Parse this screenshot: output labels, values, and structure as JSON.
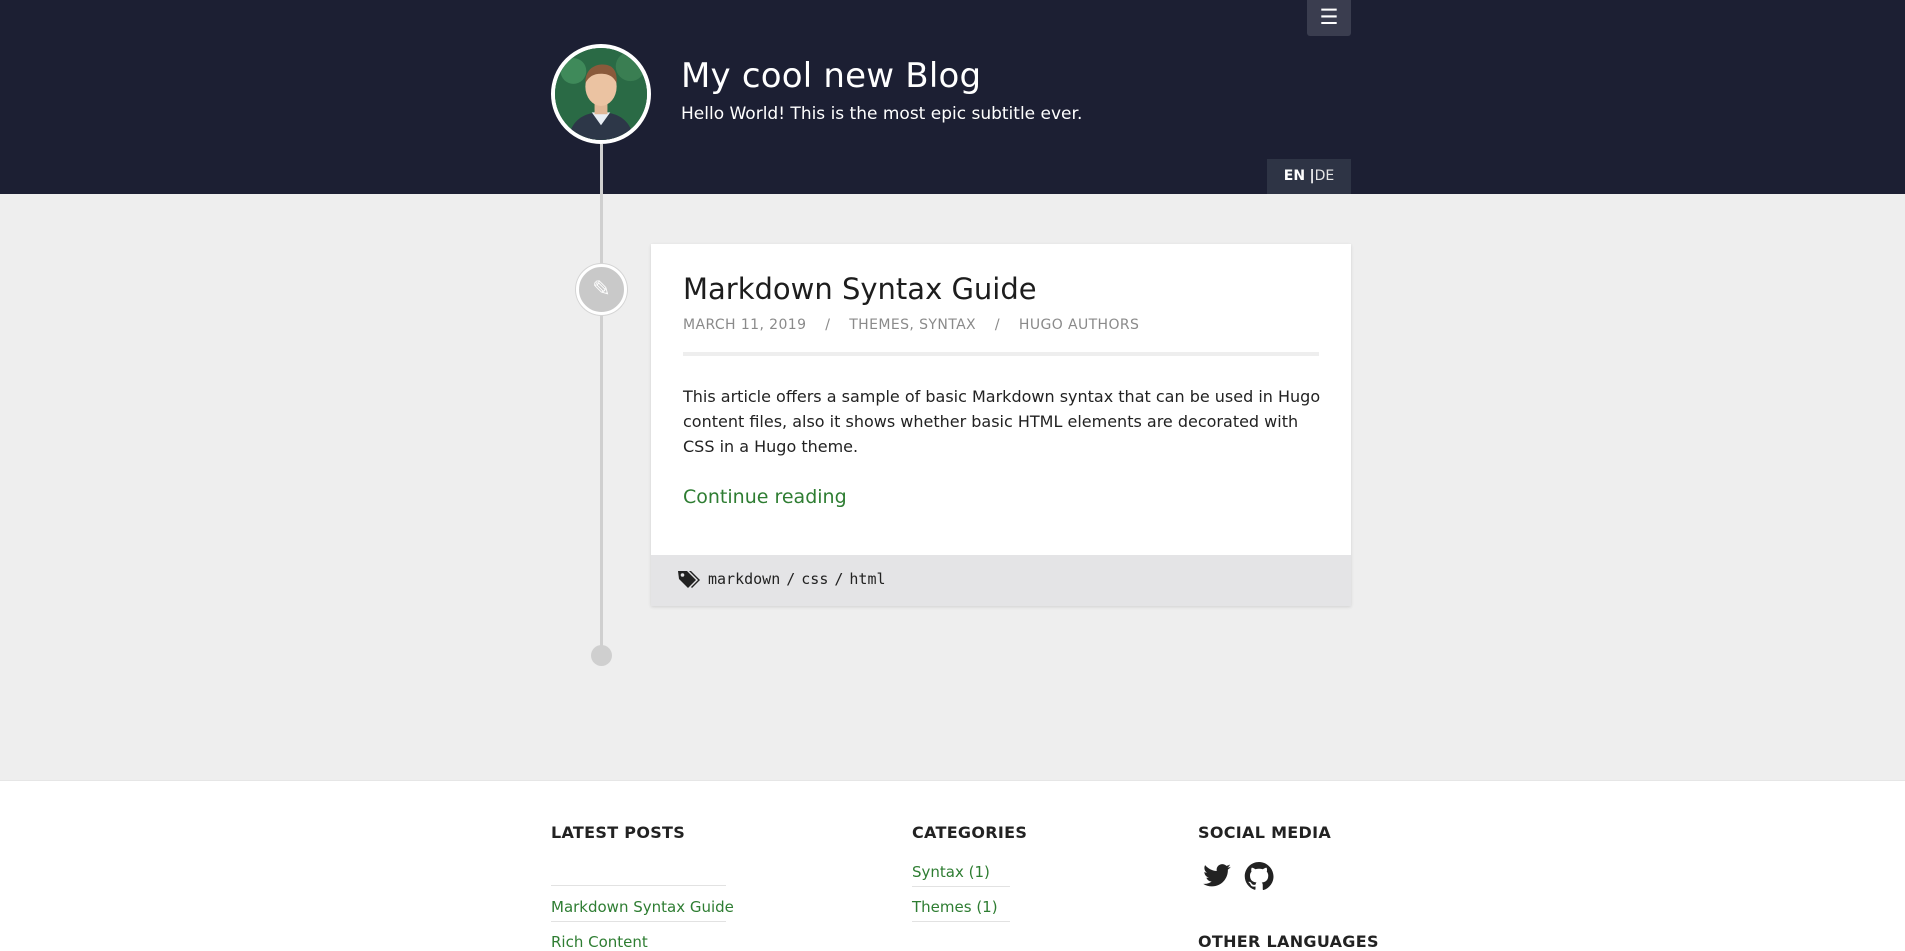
{
  "header": {
    "menu_icon": "hamburger-icon",
    "menu_glyph": "☰",
    "title": "My cool new Blog",
    "subtitle": "Hello World! This is the most epic subtitle ever.",
    "languages": {
      "current": "EN",
      "separator": "|",
      "other": "DE"
    }
  },
  "post": {
    "title": "Markdown Syntax Guide",
    "date": "MARCH 11, 2019",
    "meta_sep": "/",
    "categories": [
      {
        "label": "THEMES"
      },
      {
        "label": "SYNTAX"
      }
    ],
    "category_sep": ",",
    "author": "HUGO AUTHORS",
    "summary": "This article offers a sample of basic Markdown syntax that can be used in Hugo content files, also it shows whether basic HTML elements are decorated with CSS in a Hugo theme.",
    "continue_label": "Continue reading",
    "timeline_icon": "pencil-icon",
    "tags_icon": "tags-icon",
    "tags": [
      "markdown",
      "css",
      "html"
    ],
    "tag_sep": "/"
  },
  "footer": {
    "latest_posts": {
      "heading": "LATEST POSTS",
      "items": [
        {
          "label": "Markdown Syntax Guide"
        },
        {
          "label": "Rich Content"
        }
      ]
    },
    "categories": {
      "heading": "CATEGORIES",
      "items": [
        {
          "label": "Syntax (1)"
        },
        {
          "label": "Themes (1)"
        }
      ]
    },
    "social": {
      "heading": "SOCIAL MEDIA",
      "icons": [
        "twitter-icon",
        "github-icon"
      ]
    },
    "other_languages": {
      "heading": "OTHER LANGUAGES"
    }
  },
  "colors": {
    "header_bg": "#1c1f33",
    "link_green": "#2e7d32",
    "page_bg": "#eeeeee"
  }
}
